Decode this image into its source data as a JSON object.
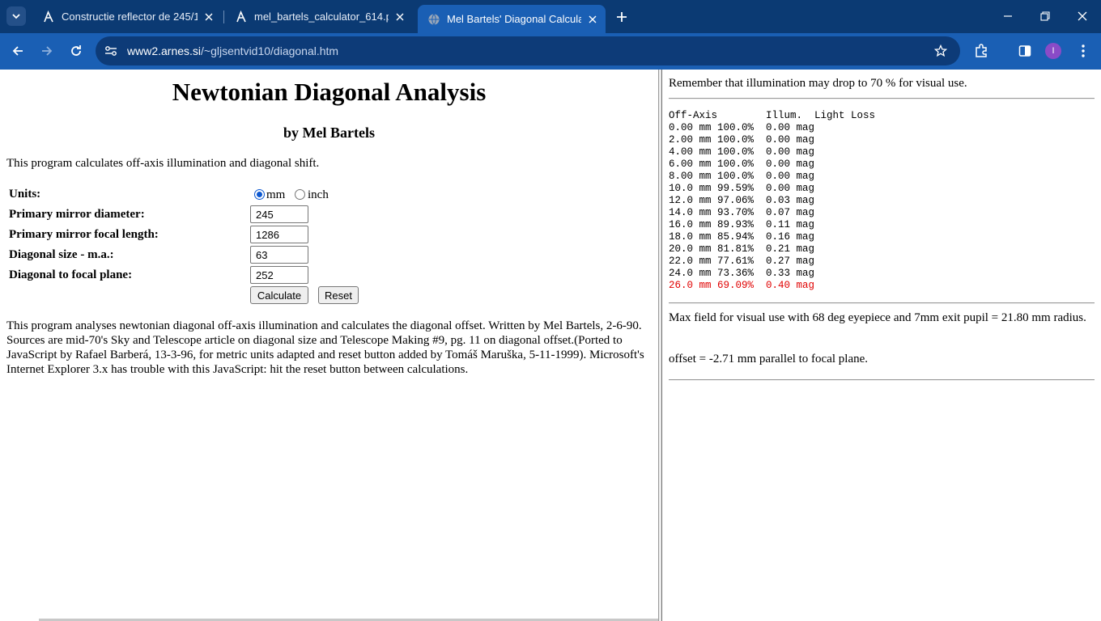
{
  "browser": {
    "tabs": [
      {
        "title": "Constructie reflector de 245/12",
        "active": false
      },
      {
        "title": "mel_bartels_calculator_614.png",
        "active": false
      },
      {
        "title": "Mel Bartels' Diagonal Calculator",
        "active": true
      }
    ],
    "url_host": "www2.arnes.si",
    "url_path": "/~gljsentvid10/diagonal.htm",
    "profile_initial": "I",
    "accent_color": "#1a5fb4"
  },
  "left": {
    "title": "Newtonian Diagonal Analysis",
    "byline": "by Mel Bartels",
    "intro": "This program calculates off-axis illumination and diagonal shift.",
    "units_label": "Units:",
    "unit_mm": "mm",
    "unit_inch": "inch",
    "fields": [
      {
        "label": "Primary mirror diameter:",
        "value": "245"
      },
      {
        "label": "Primary mirror focal length:",
        "value": "1286"
      },
      {
        "label": "Diagonal size - m.a.:",
        "value": "63"
      },
      {
        "label": "Diagonal to focal plane:",
        "value": "252"
      }
    ],
    "calculate": "Calculate",
    "reset": "Reset",
    "description": "This program analyses newtonian diagonal off-axis illumination and calculates the diagonal offset. Written by Mel Bartels, 2-6-90. Sources are mid-70's Sky and Telescope article on diagonal size and Telescope Making #9, pg. 11 on diagonal offset.(Ported to JavaScript by Rafael Barberá, 13-3-96, for metric units adapted and reset button added by Tomáš Maruška, 5-11-1999). Microsoft's Internet Explorer 3.x has trouble with this JavaScript: hit the reset button between calculations."
  },
  "right": {
    "note": "Remember that illumination may drop to 70 % for visual use.",
    "table_header": "Off-Axis        Illum.  Light Loss",
    "rows": [
      "0.00 mm 100.0%  0.00 mag",
      "2.00 mm 100.0%  0.00 mag",
      "4.00 mm 100.0%  0.00 mag",
      "6.00 mm 100.0%  0.00 mag",
      "8.00 mm 100.0%  0.00 mag",
      "10.0 mm 99.59%  0.00 mag",
      "12.0 mm 97.06%  0.03 mag",
      "14.0 mm 93.70%  0.07 mag",
      "16.0 mm 89.93%  0.11 mag",
      "18.0 mm 85.94%  0.16 mag",
      "20.0 mm 81.81%  0.21 mag",
      "22.0 mm 77.61%  0.27 mag",
      "24.0 mm 73.36%  0.33 mag"
    ],
    "highlight_row": "26.0 mm 69.09%  0.40 mag",
    "highlight_color": "#e00000",
    "max_field": "Max field for visual use with 68 deg eyepiece and 7mm exit pupil = 21.80 mm radius.",
    "offset": "offset = -2.71 mm parallel to focal plane."
  }
}
